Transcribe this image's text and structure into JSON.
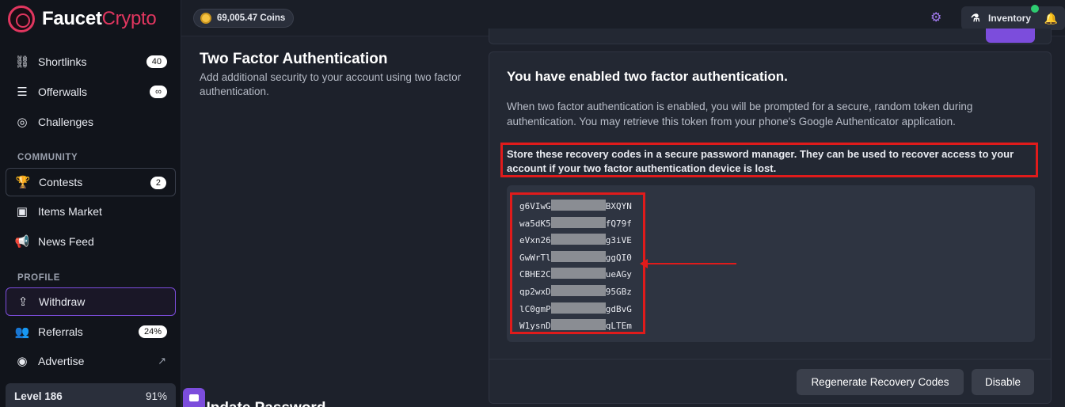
{
  "brand": {
    "name_a": "Faucet",
    "name_b": "Crypto"
  },
  "topbar": {
    "coins": "69,005.47 Coins",
    "inventory": "Inventory"
  },
  "sidebar": {
    "items_top": [
      {
        "label": "Shortlinks",
        "badge": "40",
        "icon": "link-icon"
      },
      {
        "label": "Offerwalls",
        "badge": "∞",
        "icon": "list-icon"
      },
      {
        "label": "Challenges",
        "icon": "target-icon"
      }
    ],
    "community_label": "COMMUNITY",
    "community": [
      {
        "label": "Contests",
        "badge": "2",
        "icon": "trophy-icon"
      },
      {
        "label": "Items Market",
        "icon": "market-icon"
      },
      {
        "label": "News Feed",
        "icon": "megaphone-icon"
      }
    ],
    "profile_label": "PROFILE",
    "profile": [
      {
        "label": "Withdraw",
        "icon": "withdraw-icon"
      },
      {
        "label": "Referrals",
        "badge": "24%",
        "icon": "users-icon"
      },
      {
        "label": "Advertise",
        "icon": "advertise-icon"
      }
    ],
    "level": {
      "label": "Level 186",
      "percent": "91%"
    }
  },
  "section": {
    "title": "Two Factor Authentication",
    "description": "Add additional security to your account using two factor authentication.",
    "next_title": "Update Password"
  },
  "card": {
    "heading": "You have enabled two factor authentication.",
    "text": "When two factor authentication is enabled, you will be prompted for a secure, random token during authentication. You may retrieve this token from your phone's Google Authenticator application.",
    "warning": "Store these recovery codes in a secure password manager. They can be used to recover access to your account if your two factor authentication device is lost.",
    "codes": [
      {
        "prefix": "g6VIwG",
        "suffix": "BXQYN"
      },
      {
        "prefix": "wa5dK5",
        "suffix": "fQ79f"
      },
      {
        "prefix": "eVxn26",
        "suffix": "g3iVE"
      },
      {
        "prefix": "GwWrTl",
        "suffix": "ggQI0"
      },
      {
        "prefix": "CBHE2C",
        "suffix": "ueAGy"
      },
      {
        "prefix": "qp2wxD",
        "suffix": "95GBz"
      },
      {
        "prefix": "lC0gmP",
        "suffix": "gdBvG"
      },
      {
        "prefix": "W1ysnD",
        "suffix": "qLTEm"
      }
    ],
    "buttons": {
      "regenerate": "Regenerate Recovery Codes",
      "disable": "Disable"
    }
  },
  "colors": {
    "accent": "#7c4ddc",
    "brand": "#e0365f",
    "highlight": "#e01b1b",
    "online": "#2ecc71"
  }
}
